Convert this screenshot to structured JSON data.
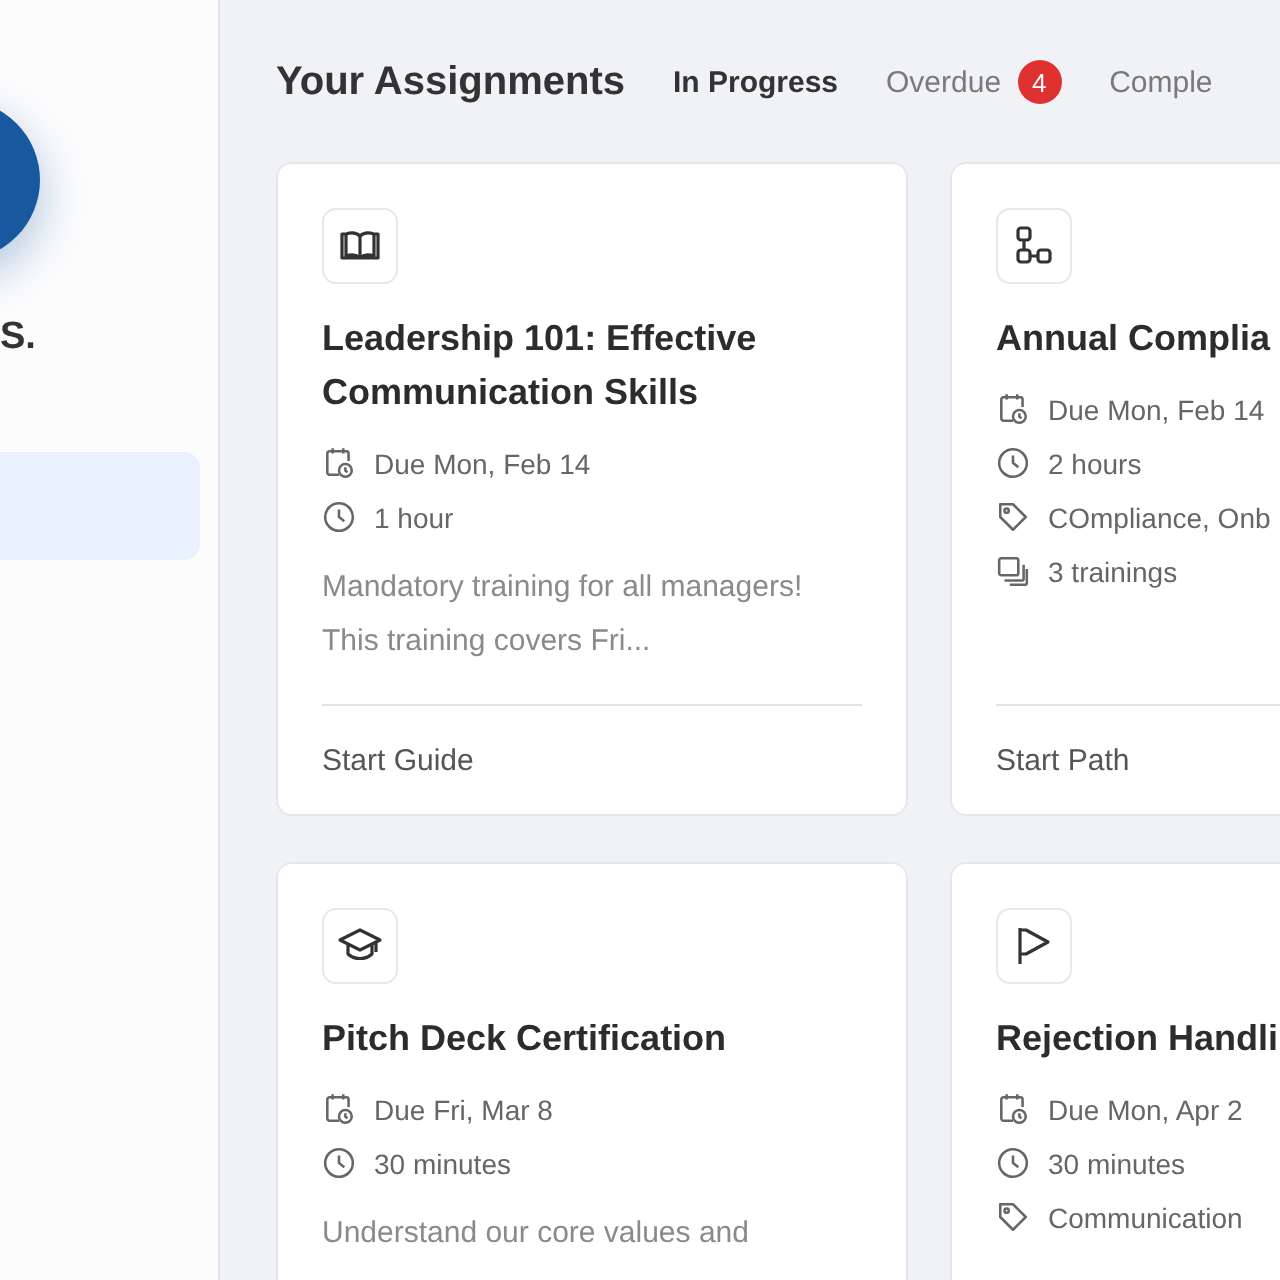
{
  "sidebar": {
    "user_name": "S.",
    "nav_items": [
      {
        "selected": true
      }
    ]
  },
  "header": {
    "title": "Your Assignments"
  },
  "tabs": [
    {
      "label": "In Progress",
      "selected": true
    },
    {
      "label": "Overdue",
      "selected": false,
      "badge": "4"
    },
    {
      "label": "Comple",
      "selected": false
    }
  ],
  "cards": [
    {
      "kind": "book",
      "title": "Leadership 101: Effective Communication Skills",
      "meta": [
        {
          "kind": "due",
          "text": "Due Mon, Feb 14"
        },
        {
          "kind": "duration",
          "text": "1 hour"
        }
      ],
      "description": "Mandatory training for all managers! This training covers Fri...",
      "action": "Start Guide"
    },
    {
      "kind": "flow",
      "title": "Annual Complia",
      "meta": [
        {
          "kind": "due",
          "text": "Due Mon, Feb 14"
        },
        {
          "kind": "duration",
          "text": "2 hours"
        },
        {
          "kind": "tags",
          "text": "COmpliance, Onb"
        },
        {
          "kind": "trainings",
          "text": "3 trainings"
        }
      ],
      "action": "Start Path"
    },
    {
      "kind": "cap",
      "title": "Pitch Deck Certification",
      "meta": [
        {
          "kind": "due",
          "text": "Due Fri, Mar 8"
        },
        {
          "kind": "duration",
          "text": "30 minutes"
        }
      ],
      "description": "Understand our core values and"
    },
    {
      "kind": "flag",
      "title": "Rejection Handli",
      "meta": [
        {
          "kind": "due",
          "text": "Due Mon, Apr 2"
        },
        {
          "kind": "duration",
          "text": "30 minutes"
        },
        {
          "kind": "tags",
          "text": "Communication"
        }
      ]
    }
  ]
}
